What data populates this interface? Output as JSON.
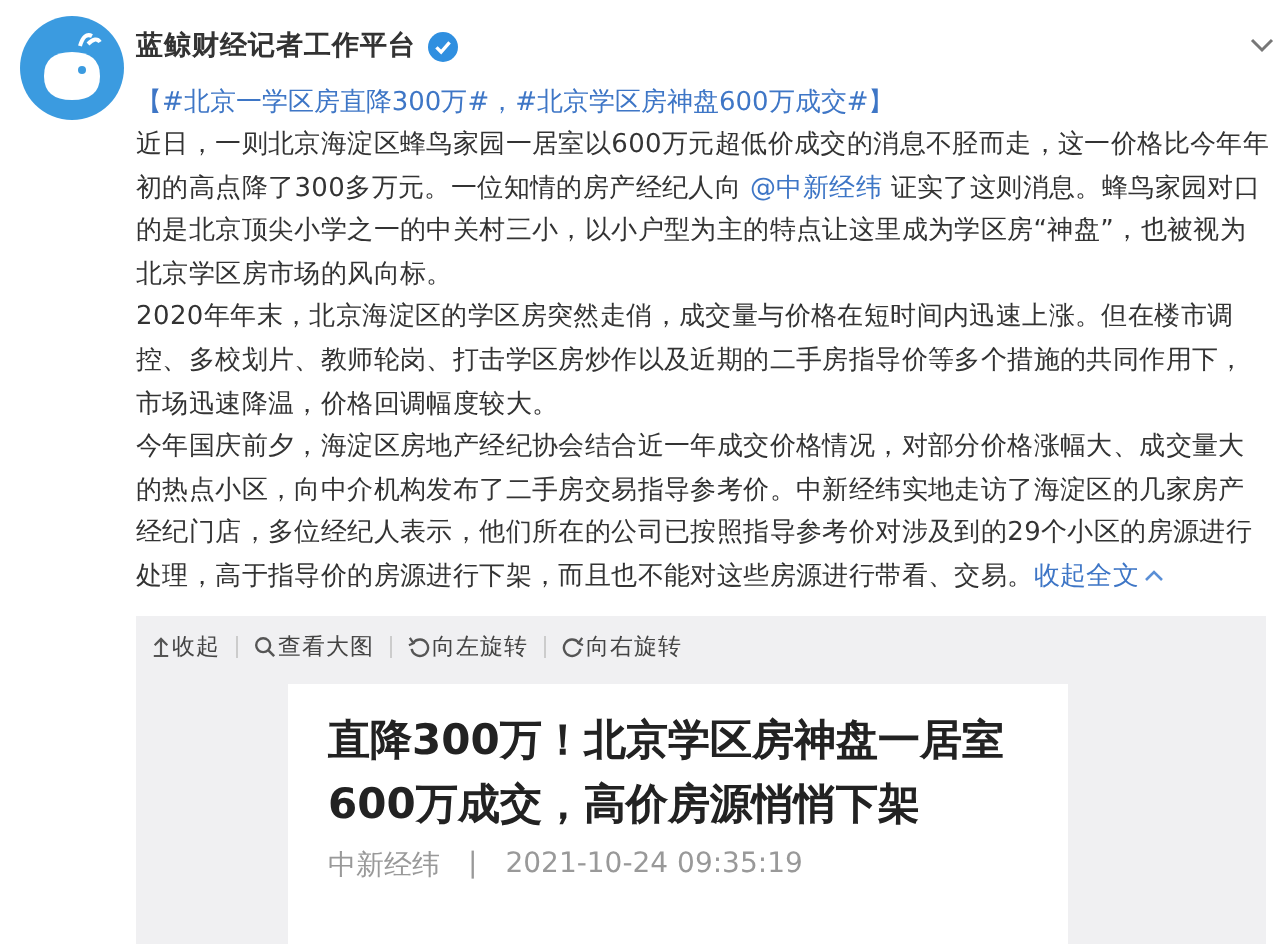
{
  "author": {
    "name": "蓝鲸财经记者工作平台",
    "verified": true
  },
  "tag_line": {
    "open": "【",
    "hashtags": [
      "#北京一学区房直降300万#",
      "#北京学区房神盘600万成交#"
    ],
    "separator": "，",
    "close": "】"
  },
  "paragraphs": [
    {
      "before": "近日，一则北京海淀区蜂鸟家园一居室以600万元超低价成交的消息不胫而走，这一价格比今年年初的高点降了300多万元。一位知情的房产经纪人向 ",
      "mention": "@中新经纬",
      "after": " 证实了这则消息。蜂鸟家园对口的是北京顶尖小学之一的中关村三小，以小户型为主的特点让这里成为学区房“神盘”，也被视为北京学区房市场的风向标。"
    },
    {
      "before": "2020年年末，北京海淀区的学区房突然走俏，成交量与价格在短时间内迅速上涨。但在楼市调控、多校划片、教师轮岗、打击学区房炒作以及近期的二手房指导价等多个措施的共同作用下，市场迅速降温，价格回调幅度较大。"
    },
    {
      "before": "今年国庆前夕，海淀区房地产经纪协会结合近一年成交价格情况，对部分价格涨幅大、成交量大的热点小区，向中介机构发布了二手房交易指导参考价。中新经纬实地走访了海淀区的几家房产经纪门店，多位经纪人表示，他们所在的公司已按照指导参考价对涉及到的29个小区的房源进行处理，高于指导价的房源进行下架，而且也不能对这些房源进行带看、交易。",
      "collapse": "收起全文"
    }
  ],
  "image_toolbar": [
    {
      "kind": "collapse",
      "label": "收起"
    },
    {
      "kind": "zoom",
      "label": "查看大图"
    },
    {
      "kind": "rotate_left",
      "label": "向左旋转"
    },
    {
      "kind": "rotate_right",
      "label": "向右旋转"
    }
  ],
  "article_card": {
    "title_lines": [
      "直降300万！北京学区房神盘一居室",
      "600万成交，高价房源悄悄下架"
    ],
    "source": "中新经纬",
    "divider": "|",
    "date": "2021-10-24 09:35:19"
  }
}
